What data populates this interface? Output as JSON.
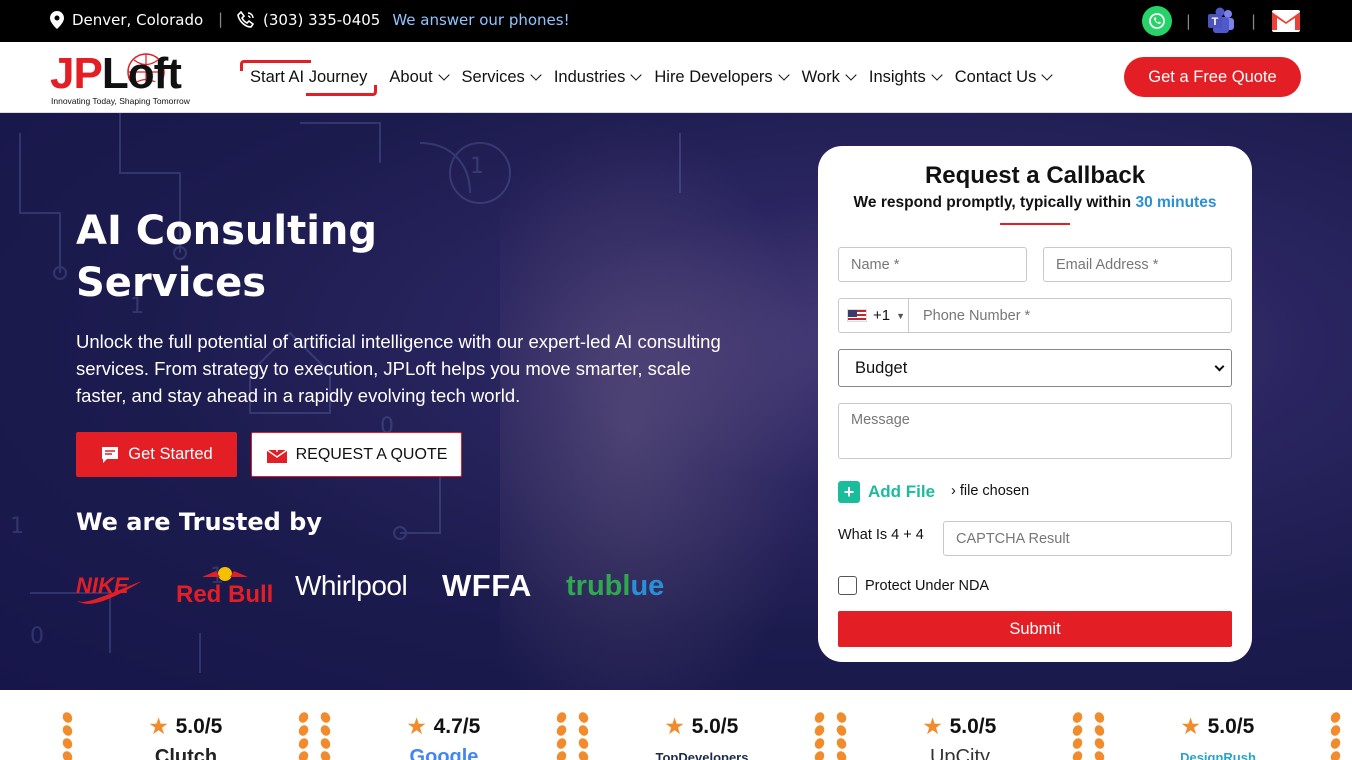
{
  "topbar": {
    "location": "Denver, Colorado",
    "phone": "(303) 335-0405",
    "answer": "We answer our phones!",
    "icons": [
      "location-pin-icon",
      "phone-icon",
      "whatsapp-icon",
      "teams-icon",
      "gmail-icon"
    ]
  },
  "nav": {
    "logo_jp": "JP",
    "logo_loft": "Loft",
    "logo_tagline": "Innovating Today, Shaping Tomorrow",
    "items": [
      {
        "label": "Start AI Journey"
      },
      {
        "label": "About"
      },
      {
        "label": "Services"
      },
      {
        "label": "Industries"
      },
      {
        "label": "Hire Developers"
      },
      {
        "label": "Work"
      },
      {
        "label": "Insights"
      },
      {
        "label": "Contact Us"
      }
    ],
    "cta": "Get a Free Quote"
  },
  "hero": {
    "title": "AI Consulting Services",
    "description": "Unlock the full potential of artificial intelligence with our expert-led AI consulting services. From strategy to execution, JPLoft helps you move smarter, scale faster, and stay ahead in a rapidly evolving tech world.",
    "btn_start": "Get Started",
    "btn_quote": "REQUEST A QUOTE",
    "trusted": "We are Trusted by",
    "brands": [
      "NIKE",
      "Red Bull",
      "Whirlpool",
      "WFFA",
      "trubl",
      "ue"
    ]
  },
  "form": {
    "title": "Request a Callback",
    "subtitle": "We respond promptly, typically within",
    "subtitle_highlight": "30 minutes",
    "name_placeholder": "Name *",
    "email_placeholder": "Email Address *",
    "country_code": "+1",
    "phone_placeholder": "Phone Number *",
    "budget": "Budget",
    "message_placeholder": "Message",
    "add_file": "Add File",
    "no_file": "› file chosen",
    "captcha_question": "What Is 4 + 4",
    "captcha_placeholder": "CAPTCHA Result",
    "nda": "Protect Under NDA",
    "submit": "Submit",
    "colors": {
      "accent": "#e31e24",
      "highlight": "#2a8fd6",
      "file": "#1bbc9b"
    }
  },
  "ratings": [
    {
      "score": "5.0/5",
      "platform": "Clutch"
    },
    {
      "score": "4.7/5",
      "platform": "Google"
    },
    {
      "score": "5.0/5",
      "platform": "TopDevelopers"
    },
    {
      "score": "5.0/5",
      "platform": "UpCity"
    },
    {
      "score": "5.0/5",
      "platform": "DesignRush"
    }
  ]
}
